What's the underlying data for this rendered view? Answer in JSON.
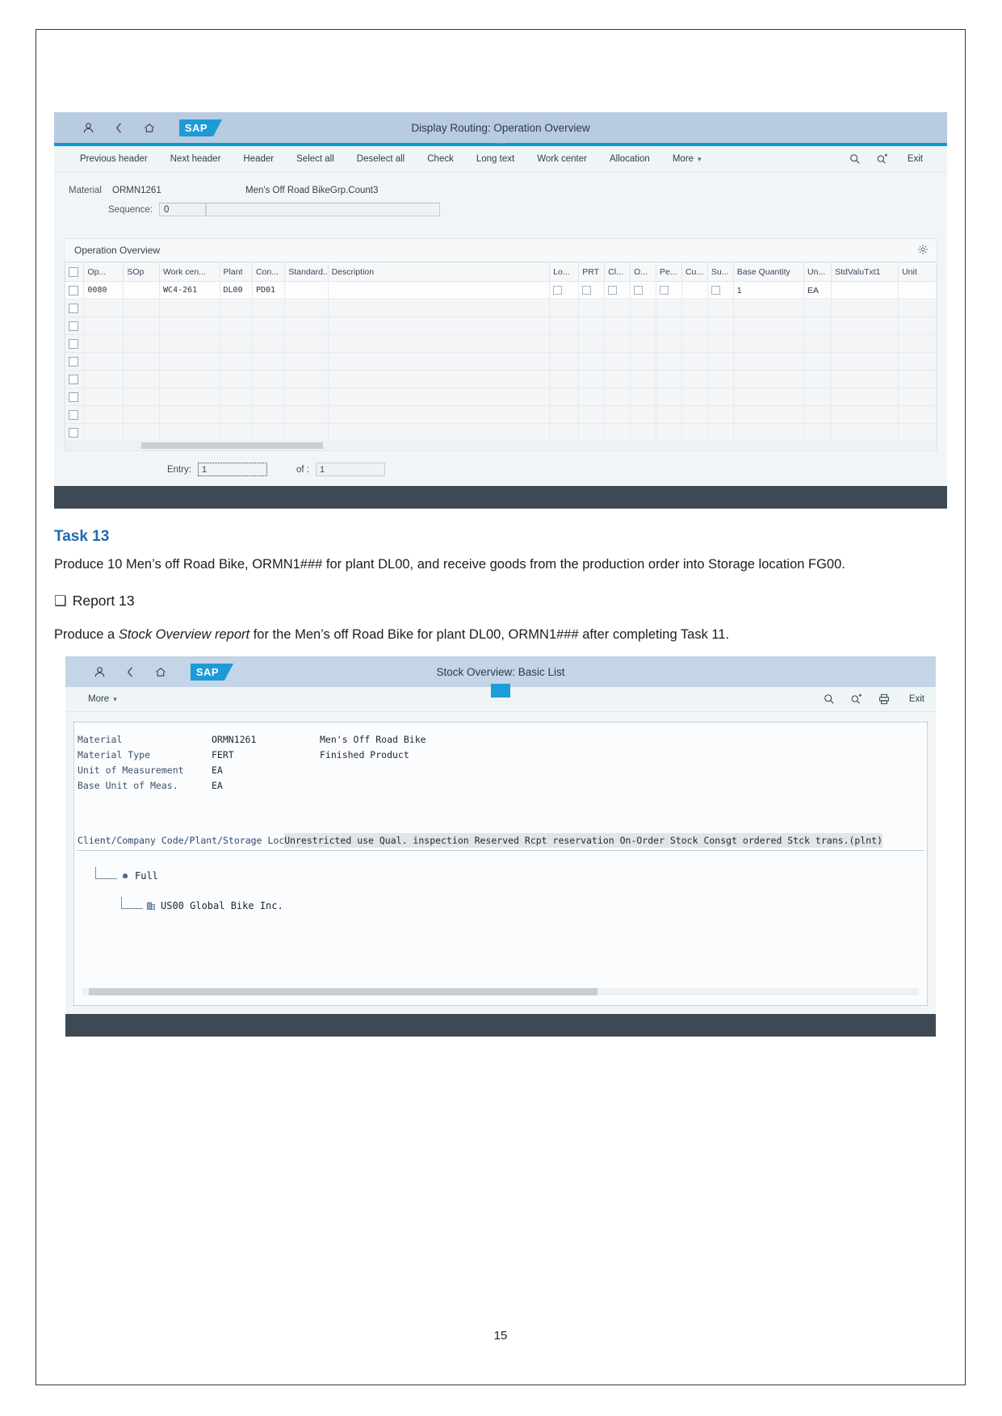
{
  "routing_window": {
    "shell": {
      "title": "Display Routing: Operation Overview",
      "logo_text": "SAP",
      "user_icon": "user-icon",
      "back_icon": "back-chevron-icon",
      "home_icon": "home-icon"
    },
    "toolbar": {
      "buttons": [
        "Previous header",
        "Next header",
        "Header",
        "Select all",
        "Deselect all",
        "Check",
        "Long text",
        "Work center",
        "Allocation"
      ],
      "more_label": "More",
      "exit_label": "Exit",
      "search_icon": "search-icon",
      "search_plus_icon": "search-plus-icon"
    },
    "form": {
      "material_label": "Material",
      "material_value": "ORMN1261",
      "material_desc": "Men's Off Road BikeGrp.Count3",
      "sequence_label": "Sequence:",
      "sequence_value": "0",
      "sequence_value2": ""
    },
    "panel_title": "Operation Overview",
    "settings_icon": "gear-icon",
    "columns": [
      "Op...",
      "SOp",
      "Work cen...",
      "Plant",
      "Con...",
      "Standard...",
      "Description",
      "Lo...",
      "PRT",
      "Cl...",
      "O...",
      "Pe...",
      "Cu...",
      "Su...",
      "Base Quantity",
      "Un...",
      "StdValuTxt1",
      "Unit"
    ],
    "row": {
      "op": "0080",
      "sop": "",
      "work_center": "WC4-261",
      "plant": "DL00",
      "con": "PD01",
      "standard": "",
      "description": "",
      "base_quantity": "1",
      "un": "EA",
      "std_valu_txt1": "",
      "unit": ""
    },
    "empty_row_count": 8,
    "entry": {
      "entry_label": "Entry:",
      "entry_value": "1",
      "of_label": "of :",
      "of_value": "1"
    }
  },
  "document": {
    "task_title": "Task 13",
    "task_text": "Produce 10 Men’s off Road Bike, ORMN1### for plant DL00, and receive goods from the production order into Storage location FG00.",
    "report_bullet": "❑",
    "report_title": "Report 13",
    "report_text_1": "Produce a ",
    "report_text_em": "Stock Overview report",
    "report_text_2": " for the Men’s off Road Bike for plant DL00, ORMN1### after completing Task 11.",
    "page_number": "15"
  },
  "stock_window": {
    "shell": {
      "title": "Stock Overview: Basic List",
      "logo_text": "SAP",
      "user_icon": "user-icon",
      "back_icon": "back-chevron-icon",
      "home_icon": "home-icon"
    },
    "toolbar": {
      "more_label": "More",
      "exit_label": "Exit",
      "search_icon": "search-icon",
      "search_plus_icon": "search-plus-icon",
      "print_icon": "printer-icon"
    },
    "fields": [
      {
        "label": "Material",
        "value": "ORMN1261",
        "desc": "Men's Off Road Bike"
      },
      {
        "label": "Material Type",
        "value": "FERT",
        "desc": "Finished Product"
      },
      {
        "label": "Unit of Measurement",
        "value": "EA",
        "desc": ""
      },
      {
        "label": "Base Unit of Meas.",
        "value": "EA",
        "desc": ""
      }
    ],
    "header_left": "Client/Company Code/Plant/Storage Loc",
    "header_right": "Unrestricted use Qual. inspection Reserved Rcpt reservation On-Order Stock Consgt ordered Stck trans.(plnt)",
    "tree": [
      {
        "label": "Full",
        "icon": "tree-node-icon"
      },
      {
        "label": "US00 Global Bike Inc.",
        "icon": "company-icon"
      }
    ]
  }
}
